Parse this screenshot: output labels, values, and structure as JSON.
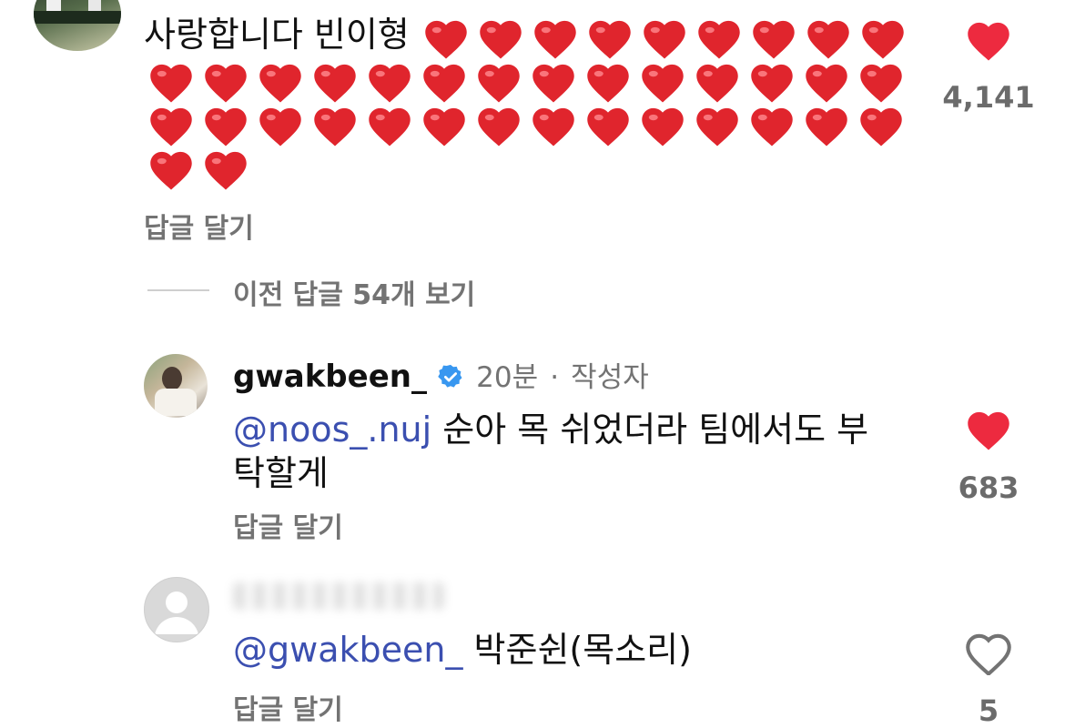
{
  "comments": [
    {
      "text": "사랑합니다 빈이형",
      "hearts": "❤️❤️❤️❤️❤️❤️❤️❤️❤️❤️❤️❤️❤️❤️❤️❤️❤️❤️❤️❤️❤️❤️❤️❤️❤️❤️❤️❤️❤️❤️❤️❤️❤️❤️❤️❤️❤️❤️❤️❤️❤️❤️❤️",
      "reply_label": "답글 달기",
      "likes": "4,141",
      "liked": true
    }
  ],
  "view_previous": "이전 답글 54개 보기",
  "author_reply": {
    "username": "gwakbeen_",
    "verified": true,
    "time": "20분",
    "separator": "·",
    "author_badge": "작성자",
    "mention": "@noos_.nuj",
    "text_line1": " 순아 목 쉬었더라 팀에서도 부",
    "text_line2": "탁할게",
    "reply_label": "답글 달기",
    "likes": "683",
    "liked": true
  },
  "user_reply": {
    "mention": "@gwakbeen_",
    "text": " 박준쉰(목소리)",
    "reply_label": "답글 달기",
    "likes": "5",
    "liked": false
  },
  "colors": {
    "like_red": "#ed2a3f",
    "mention_blue": "#3b4fb0",
    "verified_blue": "#3897f0",
    "muted_gray": "#737373"
  }
}
